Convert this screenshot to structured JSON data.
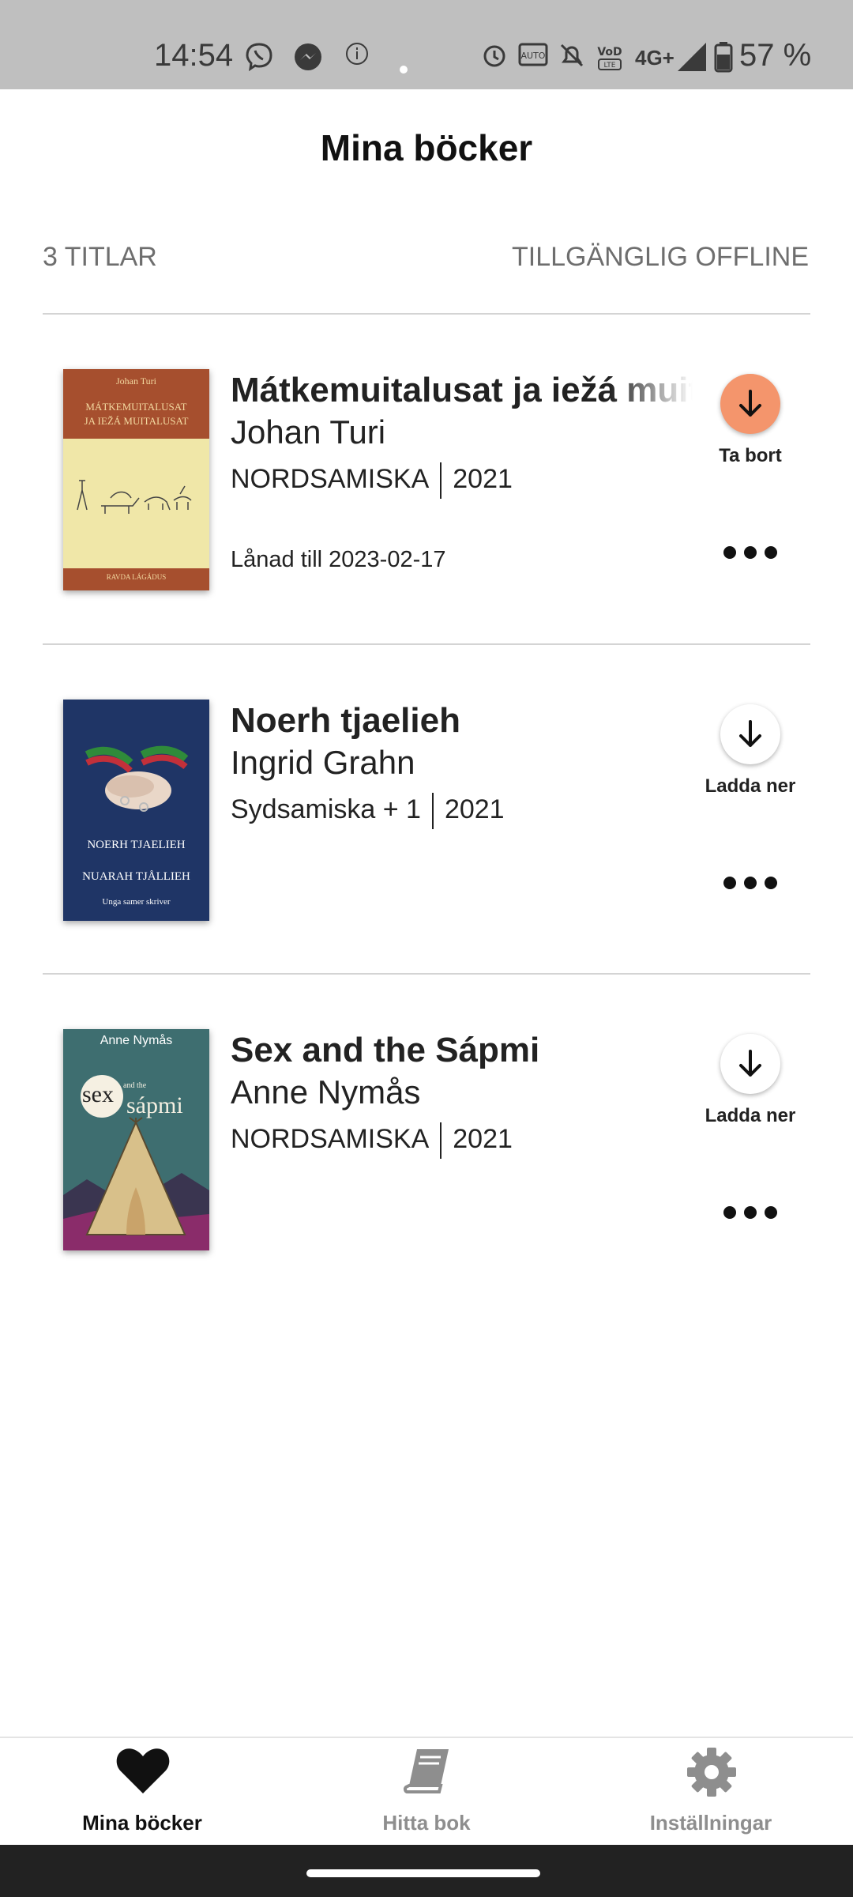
{
  "status_bar": {
    "time": "14:54",
    "battery": "57 %",
    "network": "4G+",
    "icons": [
      "viber-icon",
      "messenger-icon",
      "info-icon",
      "dot-icon",
      "alarm-icon",
      "auto-nr-icon",
      "mute-icon",
      "volte-icon",
      "signal-icon",
      "battery-icon"
    ]
  },
  "header": {
    "title": "Mina böcker",
    "count": "3 TITLAR",
    "offline": "TILLGÄNGLIG OFFLINE"
  },
  "books": [
    {
      "title": "Mátkemuitalusat ja iežá muitalusat",
      "author": "Johan Turi",
      "language": "NORDSAMISKA",
      "year": "2021",
      "loan": "Lånad till 2023-02-17",
      "action": "Ta bort",
      "downloaded": true,
      "cover": {
        "top": "Johan Turi",
        "line1": "MÁTKEMUITALUSAT",
        "line2": "JA IEŽÁ MUITALUSAT",
        "bottom": "RAVDA LÁGÁDUS"
      }
    },
    {
      "title": "Noerh tjaelieh",
      "author": "Ingrid Grahn",
      "language": "Sydsamiska + 1",
      "year": "2021",
      "loan": "",
      "action": "Ladda ner",
      "downloaded": false,
      "cover": {
        "line1": "NOERH TJAELIEH",
        "line2": "NUARAH TJÅLLIEH",
        "bottom": "Unga samer skriver"
      }
    },
    {
      "title": "Sex and the Sápmi",
      "author": "Anne Nymås",
      "language": "NORDSAMISKA",
      "year": "2021",
      "loan": "",
      "action": "Ladda ner",
      "downloaded": false,
      "cover": {
        "top": "Anne Nymås",
        "line1": "sex",
        "line2": "sápmi",
        "small": "and the"
      }
    }
  ],
  "nav": {
    "items": [
      {
        "label": "Mina böcker",
        "icon": "heart-icon",
        "active": true
      },
      {
        "label": "Hitta bok",
        "icon": "book-icon",
        "active": false
      },
      {
        "label": "Inställningar",
        "icon": "gear-icon",
        "active": false
      }
    ]
  },
  "colors": {
    "accent": "#f4956c",
    "active_nav": "#111111",
    "inactive_nav": "#8e8e8e",
    "status_bar": "#bfbfbf"
  }
}
